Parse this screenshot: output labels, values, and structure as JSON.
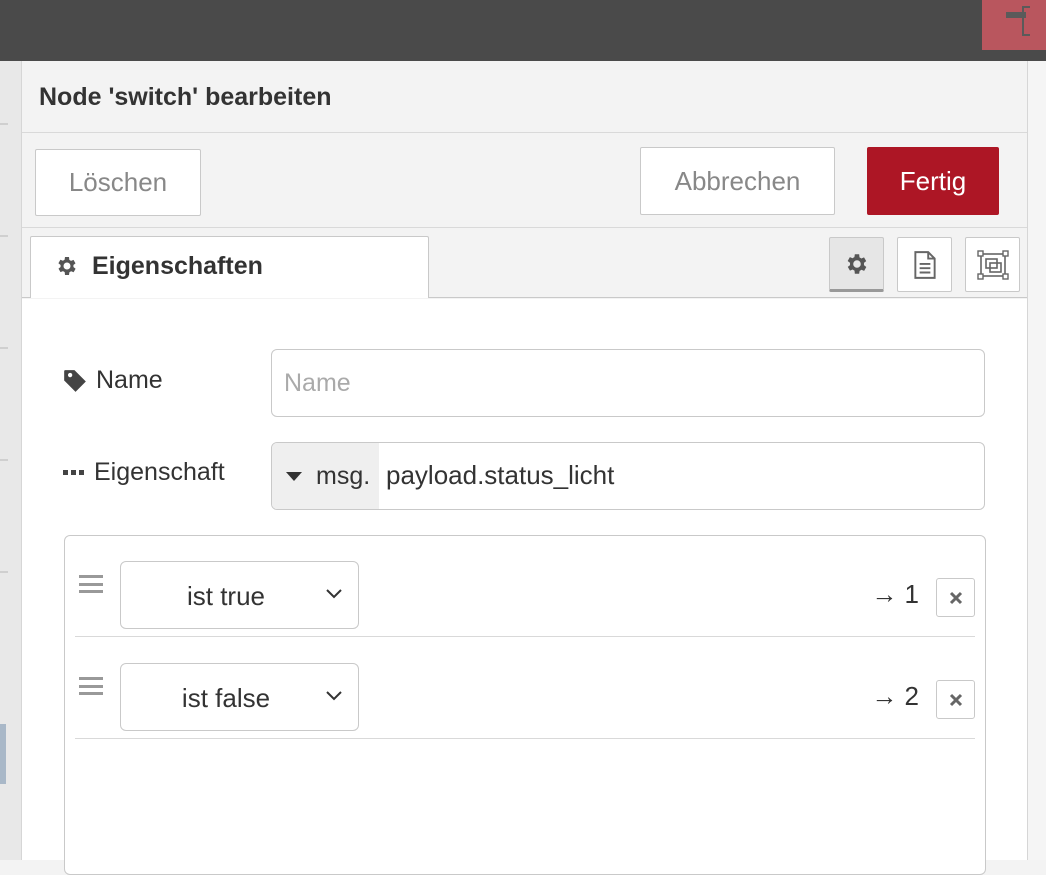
{
  "dialog": {
    "title": "Node 'switch' bearbeiten",
    "buttons": {
      "delete": "Löschen",
      "cancel": "Abbrechen",
      "done": "Fertig"
    }
  },
  "tabs": {
    "properties": "Eigenschaften",
    "icons": [
      "gear-icon",
      "description-icon",
      "appearance-icon"
    ],
    "active": "settings"
  },
  "form": {
    "name": {
      "label": "Name",
      "value": "",
      "placeholder": "Name"
    },
    "property": {
      "label": "Eigenschaft",
      "type_prefix": "msg.",
      "value": "payload.status_licht"
    },
    "rules": [
      {
        "condition": "ist true",
        "output": "→ 1"
      },
      {
        "condition": "ist false",
        "output": "→ 2"
      }
    ]
  },
  "colors": {
    "done_button": "#ad1625",
    "header_bar": "#4a4a4a"
  }
}
